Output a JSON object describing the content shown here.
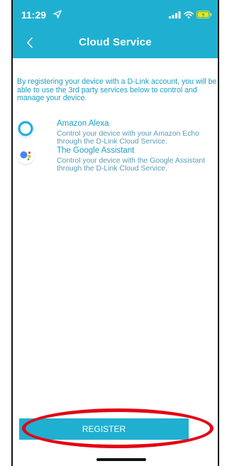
{
  "status_bar": {
    "time": "11:29"
  },
  "nav": {
    "title": "Cloud Service"
  },
  "intro_text": "By registering your device with a D-Link account, you will be able to use the 3rd party services below to control and manage your device.",
  "services": [
    {
      "name": "Amazon Alexa",
      "description": "Control your device with your Amazon Echo through the D-Link Cloud Service.",
      "icon": "alexa-icon"
    },
    {
      "name": "The Google Assistant",
      "description": "Control your device with the Google Assistant through the D-Link Cloud Service.",
      "icon": "google-assistant-icon"
    }
  ],
  "register_button": {
    "label": "REGISTER"
  },
  "colors": {
    "accent": "#1fb0d1",
    "text_link": "#1c9ec3",
    "highlight": "#e30613"
  }
}
